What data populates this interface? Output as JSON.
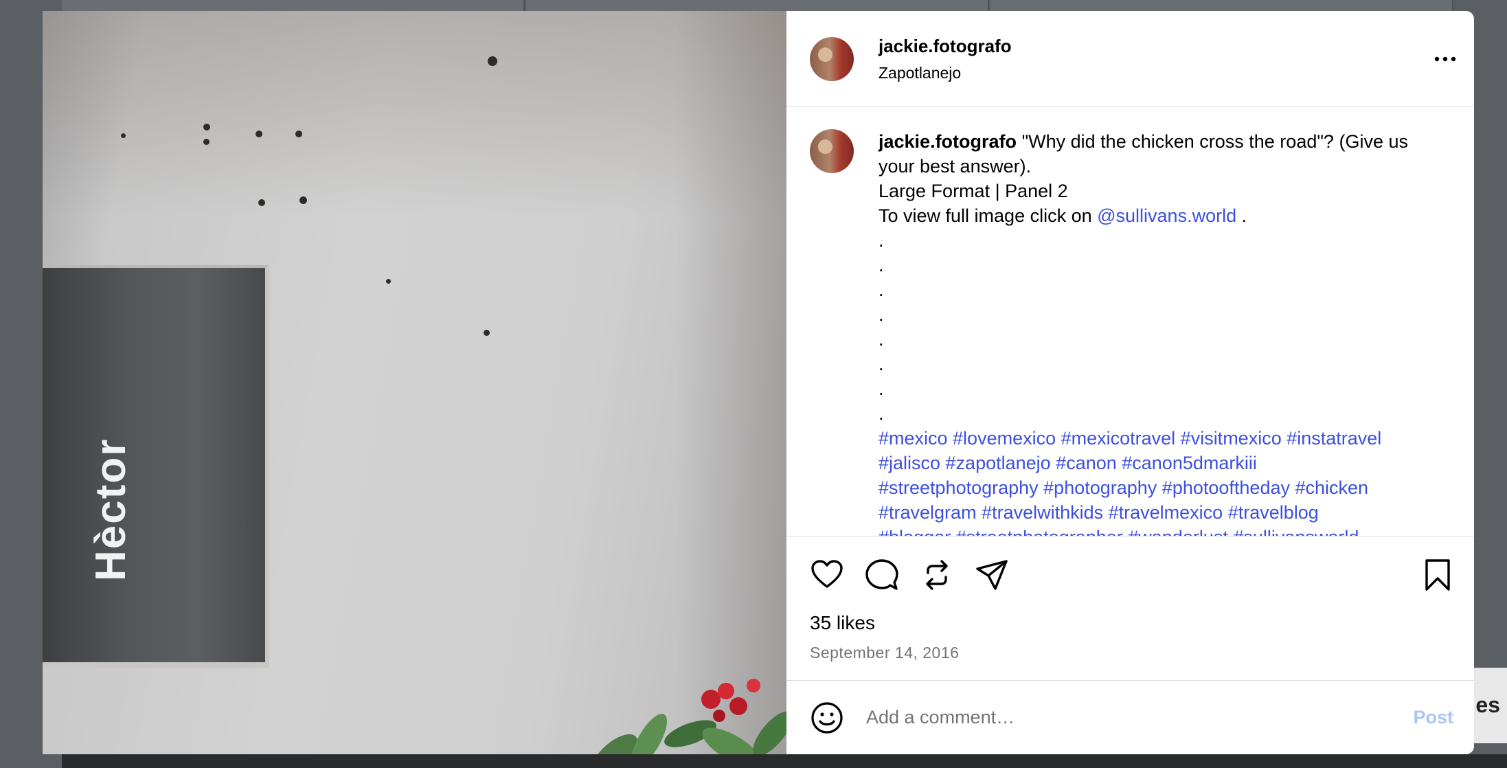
{
  "background": {
    "peek_text": "es"
  },
  "photo": {
    "signage_text": "Hèctor"
  },
  "header": {
    "username": "jackie.fotografo",
    "location": "Zapotlanejo",
    "more_icon": "more-horizontal-icon"
  },
  "caption": {
    "username": "jackie.fotografo",
    "line1": "\"Why did the chicken cross the road\"? (Give us your best answer).",
    "line2": "Large Format | Panel 2",
    "line3_prefix": "To view full image click on ",
    "mention": "@sullivans.world",
    "line3_suffix": " .",
    "dots": [
      ".",
      ".",
      ".",
      ".",
      ".",
      ".",
      ".",
      "."
    ],
    "hashtags_lines": [
      "#mexico #lovemexico #mexicotravel #visitmexico #instatravel",
      "#jalisco #zapotlanejo #canon #canon5dmarkiii",
      "#streetphotography #photography #photooftheday #chicken",
      "#travelgram #travelwithkids #travelmexico #travelblog",
      "#blogger #streetphotographer #wanderlust #sullivansworld"
    ]
  },
  "actions": {
    "like_icon": "heart-icon",
    "comment_icon": "comment-icon",
    "repost_icon": "repost-icon",
    "share_icon": "send-icon",
    "save_icon": "bookmark-icon"
  },
  "likes": "35 likes",
  "date": "September 14, 2016",
  "comment": {
    "emoji_icon": "emoji-icon",
    "placeholder": "Add a comment…",
    "post_label": "Post"
  },
  "colors": {
    "link": "#3c4fe0",
    "muted": "#737373",
    "post_disabled": "#a9c6f5"
  }
}
